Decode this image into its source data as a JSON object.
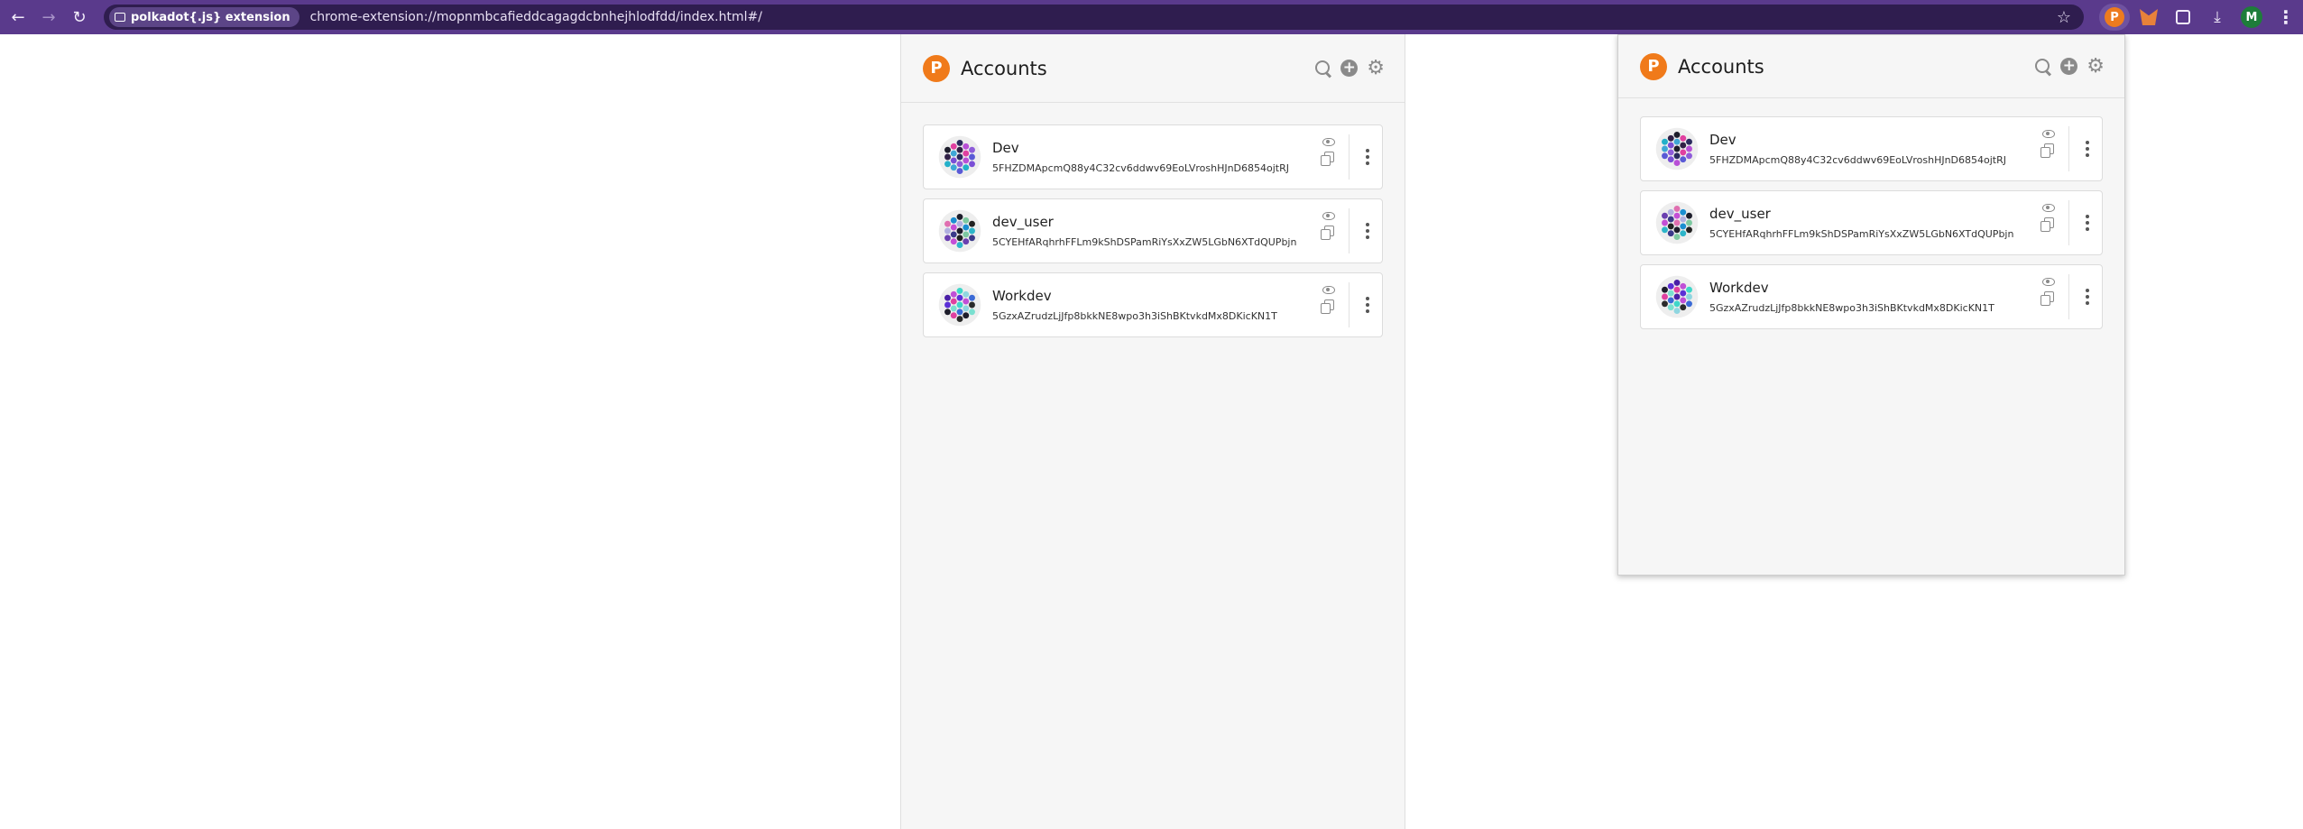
{
  "browser": {
    "extension_chip_label": "polkadot{.js} extension",
    "url": "chrome-extension://mopnmbcafieddcagagdcbnhejhlodfdd/index.html#/",
    "profile_initial": "M"
  },
  "panel": {
    "title": "Accounts",
    "logo_letter": "P"
  },
  "popup": {
    "title": "Accounts",
    "logo_letter": "P"
  },
  "accounts": [
    {
      "name": "Dev",
      "address": "5FHZDMApcmQ88y4C32cv6ddwv69EoLVroshHJnD6854ojtRJ"
    },
    {
      "name": "dev_user",
      "address": "5CYEHfARqhrhFFLm9kShDSPamRiYsXxZW5LGbN6XTdQUPbjn"
    },
    {
      "name": "Workdev",
      "address": "5GzxAZrudzLjJfp8bkkNE8wpo3h3iShBKtvkdMx8DKicKN1T"
    }
  ],
  "colors": {
    "toolbar": "#5a3a8c",
    "polkadot_orange": "#f07a1a",
    "panel_bg": "#f6f6f6"
  }
}
